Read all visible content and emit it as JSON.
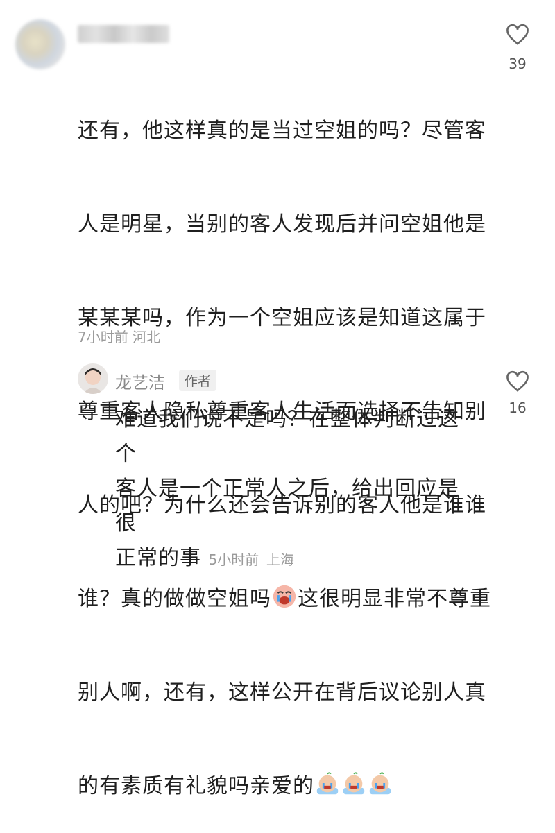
{
  "comment": {
    "lines": [
      "还有，他这样真的是当过空姐的吗？尽管客",
      "人是明星，当别的客人发现后并问空姐他是",
      "某某某吗，作为一个空姐应该是知道这属于",
      "尊重客人隐私尊重客人生活而选择不告知别",
      "人的吧？为什么还会告诉别的客人他是谁谁",
      "谁？真的做做空姐吗",
      "这很明显非常不尊重",
      "别人啊，还有，这样公开在背后议论别人真",
      "的有素质有礼貌吗亲爱的"
    ],
    "time": "7小时前",
    "location": "河北",
    "likes": "39",
    "emoji_crying": "crying-emoji",
    "emoji_bread": "crying-bread-emoji"
  },
  "reply": {
    "author": "龙艺洁",
    "badge": "作者",
    "lines": [
      "难道我们说不是吗？在整体判断过这个",
      "客人是一个正常人之后，给出回应是很",
      "正常的事"
    ],
    "time": "5小时前",
    "location": "上海",
    "likes": "16"
  },
  "icons": {
    "like": "heart-outline-icon"
  }
}
